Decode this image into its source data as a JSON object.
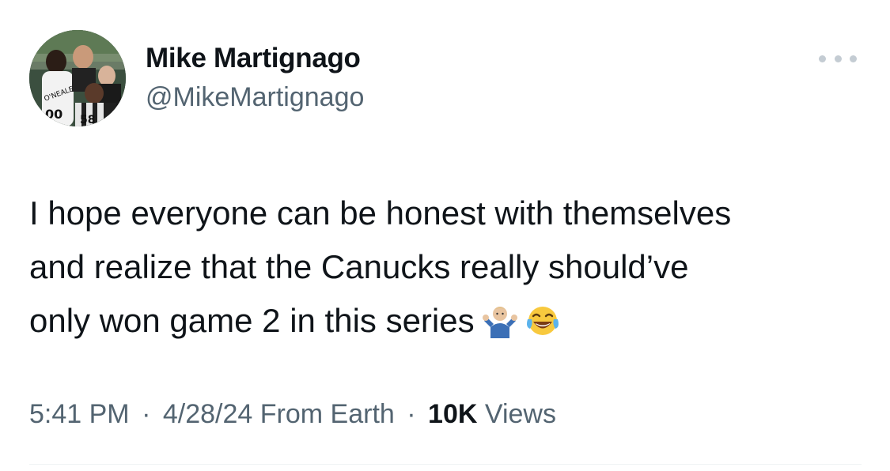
{
  "author": {
    "name": "Mike Martignago",
    "handle": "@MikeMartignago"
  },
  "tweet": {
    "text_lines": [
      "I hope everyone can be honest with themselves",
      "and realize that the Canucks really should’ve",
      "only won game 2 in this series"
    ],
    "emojis": [
      "person-shrugging-emoji",
      "face-with-tears-of-joy-emoji"
    ]
  },
  "meta": {
    "time": "5:41 PM",
    "separator": "·",
    "date": "4/28/24",
    "source": "From Earth",
    "views_count": "10K",
    "views_label": "Views"
  },
  "colors": {
    "text_primary": "#0f1419",
    "text_secondary": "#536471",
    "divider": "#eff3f4"
  }
}
